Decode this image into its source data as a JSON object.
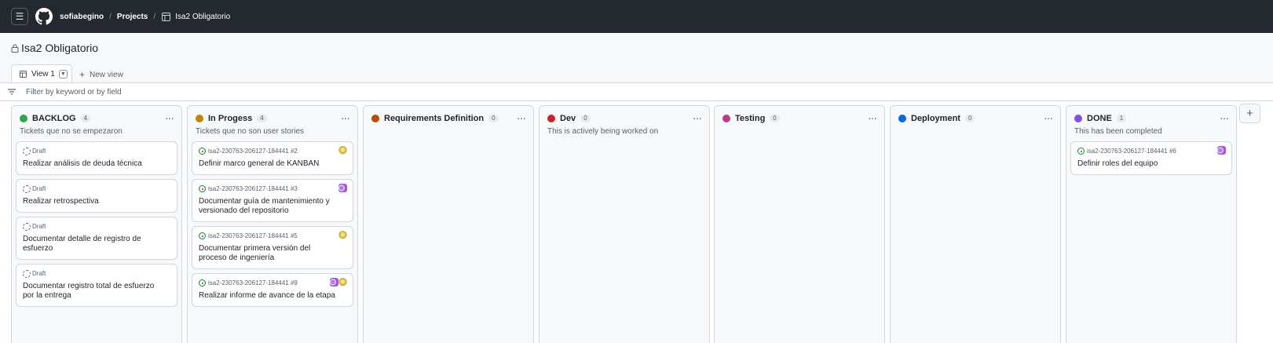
{
  "topbar": {
    "breadcrumb": {
      "owner": "sofiabegino",
      "sep1": "/",
      "projects": "Projects",
      "sep2": "/",
      "project": "Isa2 Obligatorio"
    }
  },
  "project": {
    "title": "Isa2 Obligatorio",
    "views": {
      "active_tab": "View 1",
      "new_view": "New view"
    },
    "filter_placeholder": "Filter by keyword or by field"
  },
  "colors": {
    "backlog": "#2da44e",
    "in_progress": "#bf8700",
    "requirements": "#bc4c00",
    "dev": "#cf222e",
    "testing": "#bf3989",
    "deployment": "#0969da",
    "done": "#8250df"
  },
  "columns": [
    {
      "name": "BACKLOG",
      "count": "4",
      "description": "Tickets que no se empezaron",
      "color": "#2da44e",
      "cards": [
        {
          "meta": "Draft",
          "title": "Realizar análisis de deuda técnica"
        },
        {
          "meta": "Draft",
          "title": "Realizar retrospectiva"
        },
        {
          "meta": "Draft",
          "title": "Documentar detalle de registro de esfuerzo"
        },
        {
          "meta": "Draft",
          "title": "Documentar registro total de esfuerzo por la entrega"
        }
      ]
    },
    {
      "name": "In Progess",
      "count": "4",
      "description": "Tickets que no son user stories",
      "color": "#bf8700",
      "cards": [
        {
          "meta": "isa2-230763-206127-184441 #2",
          "title": "Definir marco general de KANBAN"
        },
        {
          "meta": "isa2-230763-206127-184441 #3",
          "title": "Documentar guía de mantenimiento y versionado del repositorio"
        },
        {
          "meta": "isa2-230763-206127-184441 #5",
          "title": "Documentar primera versión del proceso de ingeniería"
        },
        {
          "meta": "isa2-230763-206127-184441 #9",
          "title": "Realizar informe de avance de la etapa"
        }
      ]
    },
    {
      "name": "Requirements Definition",
      "count": "0",
      "description": "",
      "color": "#bc4c00",
      "cards": []
    },
    {
      "name": "Dev",
      "count": "0",
      "description": "This is actively being worked on",
      "color": "#cf222e",
      "cards": []
    },
    {
      "name": "Testing",
      "count": "0",
      "description": "",
      "color": "#bf3989",
      "cards": []
    },
    {
      "name": "Deployment",
      "count": "0",
      "description": "",
      "color": "#0969da",
      "cards": []
    },
    {
      "name": "DONE",
      "count": "1",
      "description": "This has been completed",
      "color": "#8250df",
      "cards": [
        {
          "meta": "isa2-230763-206127-184441 #6",
          "title": "Definir roles del equipo"
        }
      ]
    }
  ],
  "icons": {
    "menu": "hamburger-icon",
    "logo": "github-logo-icon",
    "table": "table-icon",
    "lock": "lock-icon",
    "filter": "filter-icon",
    "more": "kebab-icon",
    "add": "plus-icon",
    "draft": "draft-circle-icon",
    "issue": "issue-open-icon"
  }
}
